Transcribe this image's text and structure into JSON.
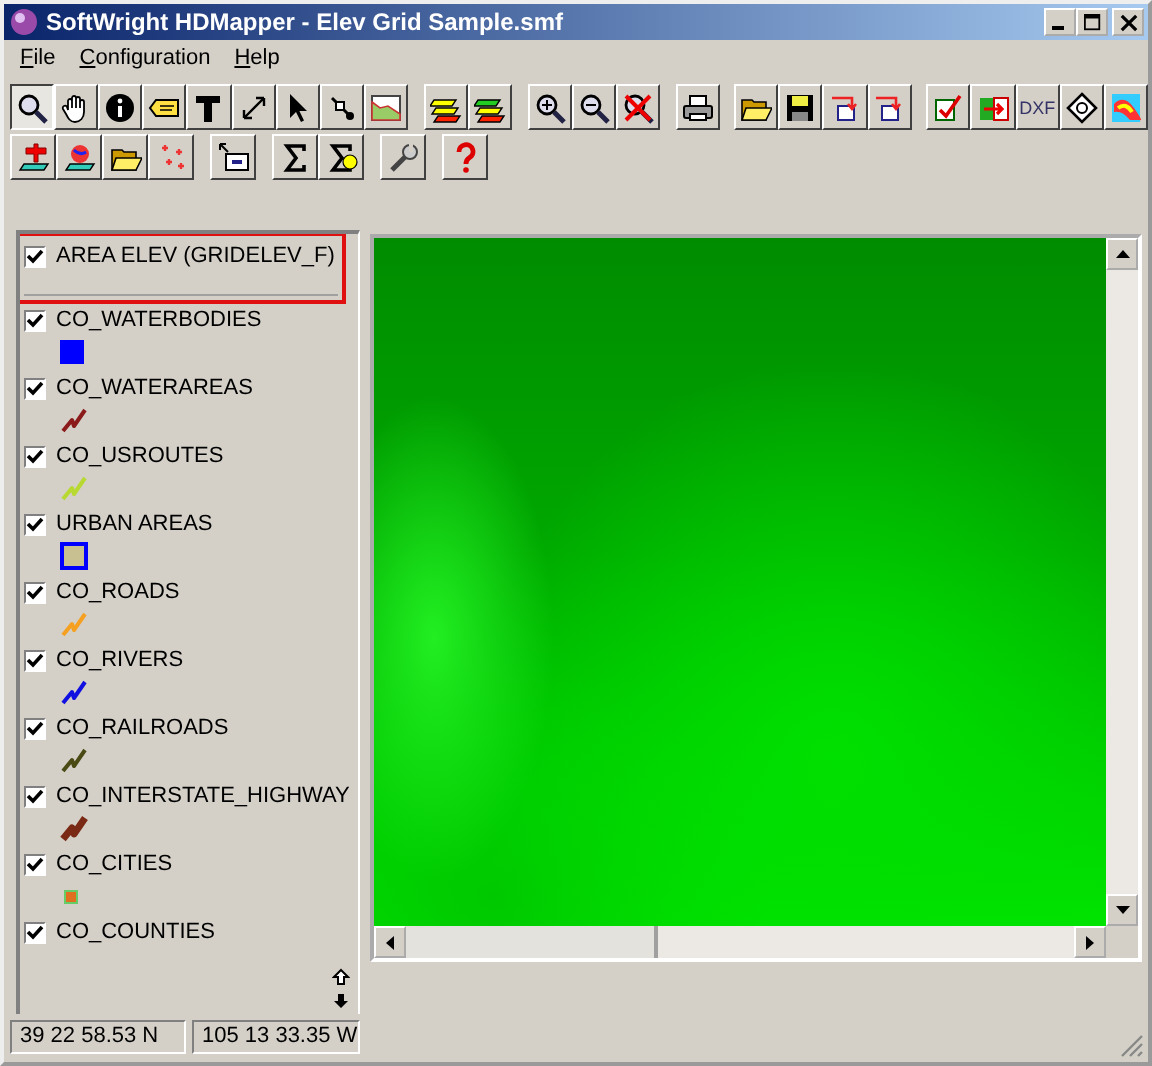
{
  "window": {
    "title": "SoftWright HDMapper - Elev Grid Sample.smf"
  },
  "menu": [
    {
      "label": "File"
    },
    {
      "label": "Configuration"
    },
    {
      "label": "Help"
    }
  ],
  "toolbar": [
    [
      {
        "kind": "magnifier",
        "selected": true
      },
      {
        "kind": "hand",
        "selected": false
      },
      {
        "kind": "info",
        "selected": false
      },
      {
        "kind": "tag",
        "selected": false
      },
      {
        "kind": "text",
        "selected": false
      },
      {
        "kind": "resize",
        "selected": false
      },
      {
        "kind": "pointer",
        "selected": false
      },
      {
        "kind": "node",
        "selected": false
      },
      {
        "kind": "profile",
        "selected": false
      },
      {
        "kind": "separator"
      },
      {
        "kind": "layers-yellow",
        "selected": false
      },
      {
        "kind": "layers-green",
        "selected": false
      },
      {
        "kind": "separator"
      },
      {
        "kind": "zoom-in",
        "selected": false
      },
      {
        "kind": "zoom-out",
        "selected": false
      },
      {
        "kind": "zoom-cancel",
        "selected": false
      },
      {
        "kind": "separator"
      },
      {
        "kind": "printer",
        "selected": false
      },
      {
        "kind": "separator"
      },
      {
        "kind": "folder",
        "selected": false
      },
      {
        "kind": "save",
        "selected": false
      },
      {
        "kind": "export",
        "selected": false
      },
      {
        "kind": "export",
        "selected": false
      },
      {
        "kind": "separator"
      },
      {
        "kind": "check",
        "selected": false
      },
      {
        "kind": "import",
        "selected": false
      },
      {
        "kind": "label",
        "label": "DXF",
        "selected": false
      },
      {
        "kind": "diamond",
        "selected": false
      },
      {
        "kind": "colormap",
        "selected": false
      }
    ],
    [
      {
        "kind": "layer-add",
        "selected": false
      },
      {
        "kind": "layer-globe",
        "selected": false
      },
      {
        "kind": "layer-open",
        "selected": false
      },
      {
        "kind": "points",
        "selected": false
      },
      {
        "kind": "separator"
      },
      {
        "kind": "select-box",
        "selected": false
      },
      {
        "kind": "separator"
      },
      {
        "kind": "sigma",
        "selected": false
      },
      {
        "kind": "sigma-face",
        "selected": false
      },
      {
        "kind": "separator"
      },
      {
        "kind": "wrench",
        "selected": false
      },
      {
        "kind": "separator"
      },
      {
        "kind": "help",
        "selected": false
      }
    ]
  ],
  "layers": [
    {
      "name": "AREA ELEV (GRIDELEV_F)",
      "checked": true,
      "highlighted": true
    },
    {
      "name": "CO_WATERBODIES",
      "checked": true,
      "kind": "fill",
      "color": "#0000ff"
    },
    {
      "name": "CO_WATERAREAS",
      "checked": true,
      "kind": "line",
      "color": "#8b1a1a"
    },
    {
      "name": "CO_USROUTES",
      "checked": true,
      "kind": "line",
      "color": "#b8d832"
    },
    {
      "name": "URBAN AREAS",
      "checked": true,
      "kind": "outline",
      "color": "#0000ff"
    },
    {
      "name": "CO_ROADS",
      "checked": true,
      "kind": "line",
      "color": "#f5a020"
    },
    {
      "name": "CO_RIVERS",
      "checked": true,
      "kind": "line",
      "color": "#1010e0"
    },
    {
      "name": "CO_RAILROADS",
      "checked": true,
      "kind": "line",
      "color": "#4a4a14"
    },
    {
      "name": "CO_INTERSTATE_HIGHWAY",
      "checked": true,
      "kind": "thick-line",
      "color": "#7a2a14"
    },
    {
      "name": "CO_CITIES",
      "checked": true,
      "kind": "point",
      "color": "#e07020"
    },
    {
      "name": "CO_COUNTIES",
      "checked": true
    }
  ],
  "status_bar": {
    "latitude": "39 22 58.53 N",
    "longitude": "105 13 33.35 W"
  }
}
